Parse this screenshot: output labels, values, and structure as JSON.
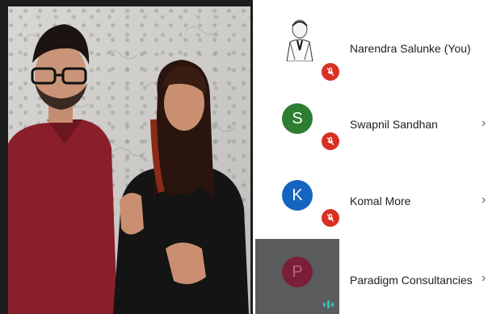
{
  "participants": [
    {
      "name": "Narendra Salunke (You)",
      "avatar_icon": "sketch-portrait-avatar",
      "muted": true,
      "has_chevron": false
    },
    {
      "name": "Swapnil Sandhan",
      "initial": "S",
      "avatar_color": "#2e7d32",
      "muted": true,
      "has_chevron": true,
      "chevron": "›"
    },
    {
      "name": "Komal More",
      "initial": "K",
      "avatar_color": "#1565c0",
      "muted": true,
      "has_chevron": true,
      "chevron": "›"
    },
    {
      "name": "Paradigm Consultancies",
      "initial": "P",
      "avatar_color": "#8e1c3c",
      "muted": false,
      "speaking": true,
      "has_chevron": true,
      "chevron": "›"
    }
  ],
  "colors": {
    "mute_badge": "#d93025",
    "speaking": "#29c5b8"
  }
}
